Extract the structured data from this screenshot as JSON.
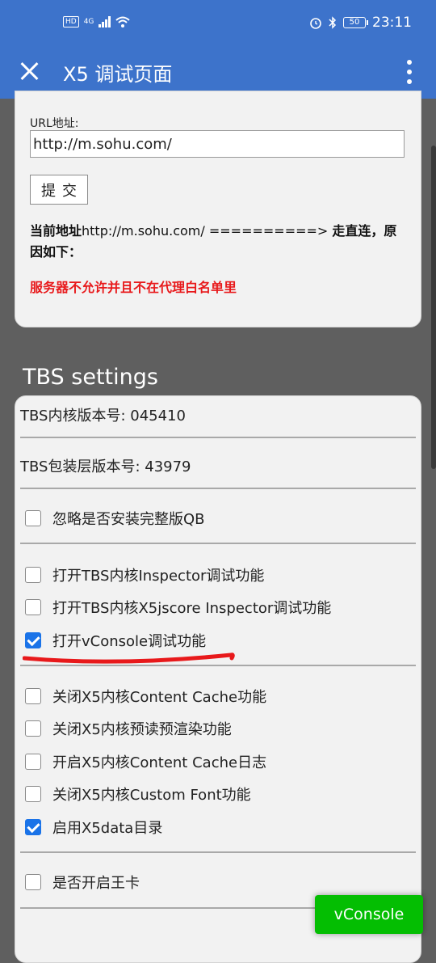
{
  "status_bar": {
    "network": "4G",
    "hd": "HD",
    "battery": "50",
    "time": "23:11"
  },
  "app_bar": {
    "title": "X5 调试页面"
  },
  "url_form": {
    "label": "URL地址:",
    "value": "http://m.sohu.com/",
    "submit_label": "提交"
  },
  "status": {
    "prefix": "当前地址",
    "url": "http://m.sohu.com/",
    "arrow": " ==========> ",
    "suffix": "走直连，原因如下：",
    "error": "服务器不允许并且不在代理白名单里"
  },
  "tbs": {
    "heading": "TBS settings",
    "core_version": "TBS内核版本号: 045410",
    "sdk_version": "TBS包装层版本号: 43979",
    "options": [
      {
        "label": "忽略是否安装完整版QB",
        "checked": false
      },
      {
        "label": "打开TBS内核Inspector调试功能",
        "checked": false
      },
      {
        "label": "打开TBS内核X5jscore Inspector调试功能",
        "checked": false
      },
      {
        "label": "打开vConsole调试功能",
        "checked": true
      },
      {
        "label": "关闭X5内核Content Cache功能",
        "checked": false
      },
      {
        "label": "关闭X5内核预读预渲染功能",
        "checked": false
      },
      {
        "label": "开启X5内核Content Cache日志",
        "checked": false
      },
      {
        "label": "关闭X5内核Custom Font功能",
        "checked": false
      },
      {
        "label": "启用X5data目录",
        "checked": true
      },
      {
        "label": "是否开启王卡",
        "checked": false
      }
    ]
  },
  "vconsole": {
    "label": "vConsole",
    "color": "#04be02"
  },
  "colors": {
    "accent": "#3d73cb",
    "error": "#e8191b",
    "annotation": "#e8191b"
  }
}
